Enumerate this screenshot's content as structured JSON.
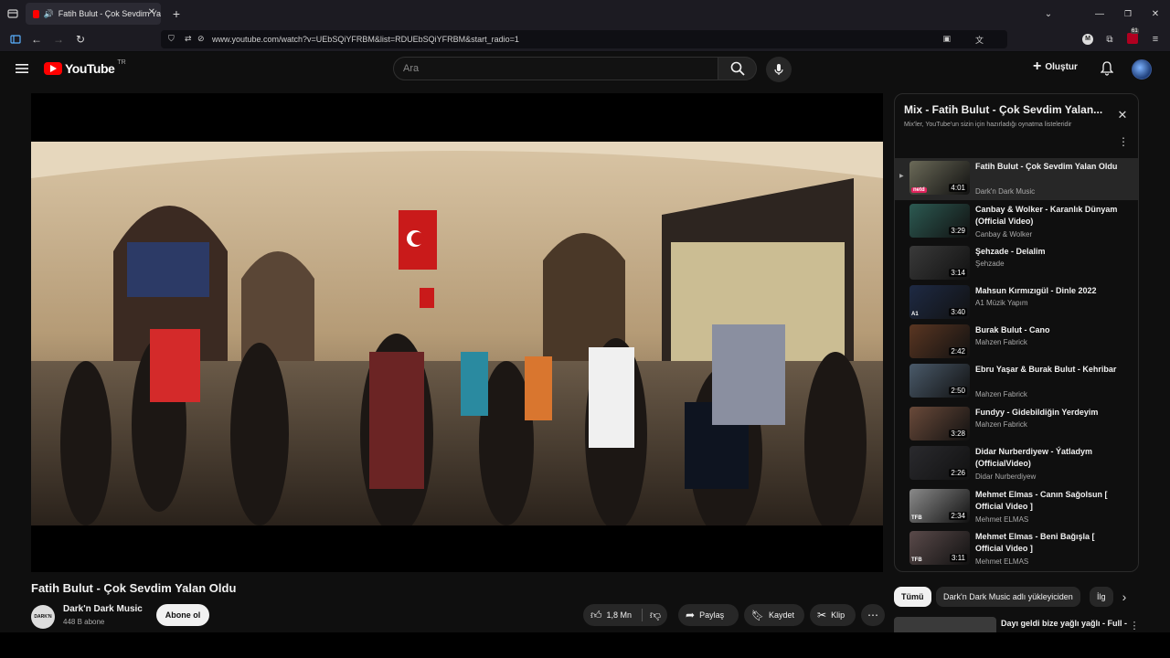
{
  "browser": {
    "tab_title": "Fatih Bulut - Çok Sevdim Ya",
    "url": "www.youtube.com/watch?v=UEbSQiYFRBM&list=RDUEbSQiYFRBM&start_radio=1",
    "new_tab_symbol": "+",
    "ext_badge": "61",
    "ext_m_letter": "M"
  },
  "youtube": {
    "logo_text": "YouTube",
    "region": "TR",
    "search_placeholder": "Ara",
    "create_label": "Oluştur"
  },
  "video": {
    "title": "Fatih Bulut - Çok Sevdim Yalan Oldu",
    "channel": "Dark'n Dark Music",
    "subscribers": "448 B abone",
    "subscribe_label": "Abone ol",
    "likes": "1,8 Mn",
    "share_label": "Paylaş",
    "save_label": "Kaydet",
    "clip_label": "Klip"
  },
  "playlist": {
    "title": "Mix - Fatih Bulut - Çok Sevdim Yalan...",
    "subtitle": "Mix'ler, YouTube'un sizin için hazırladığı oynatma listeleridir",
    "items": [
      {
        "title": "Fatih Bulut - Çok Sevdim Yalan Oldu",
        "channel": "Dark'n Dark Music",
        "duration": "4:01",
        "active": true,
        "thumb_color": "#6b6a58",
        "badge": "netd"
      },
      {
        "title": "Canbay & Wolker - Karanlık Dünyam (Official Video)",
        "channel": "Canbay & Wolker",
        "duration": "3:29",
        "thumb_color": "#2c5a52"
      },
      {
        "title": "Şehzade - Delalim",
        "channel": "Şehzade",
        "duration": "3:14",
        "thumb_color": "#3a3a3a"
      },
      {
        "title": "Mahsun Kırmızıgül - Dinle 2022",
        "channel": "A1 Müzik Yapım",
        "duration": "3:40",
        "thumb_color": "#1e2a44",
        "badge": "A1"
      },
      {
        "title": "Burak Bulut - Cano",
        "channel": "Mahzen Fabrick",
        "duration": "2:42",
        "thumb_color": "#5a3622"
      },
      {
        "title": "Ebru Yaşar & Burak Bulut - Kehribar",
        "channel": "Mahzen Fabrick",
        "duration": "2:50",
        "thumb_color": "#4a5a6a"
      },
      {
        "title": "Fundyy - Gidebildiğin Yerdeyim",
        "channel": "Mahzen Fabrick",
        "duration": "3:28",
        "thumb_color": "#6a4a3a"
      },
      {
        "title": "Didar Nurberdiyew - Ýatladym (OfficialVideo)",
        "channel": "Didar Nurberdiyew",
        "duration": "2:26",
        "thumb_color": "#2a2a2e"
      },
      {
        "title": "Mehmet Elmas - Canın Sağolsun [ Official Video ]",
        "channel": "Mehmet ELMAS",
        "duration": "2:34",
        "thumb_color": "#8a8a8a",
        "badge": "TFB"
      },
      {
        "title": "Mehmet Elmas - Beni Bağışla [ Official Video ]",
        "channel": "Mehmet ELMAS",
        "duration": "3:11",
        "thumb_color": "#5a4a4a",
        "badge": "TFB"
      }
    ]
  },
  "chips": [
    {
      "label": "Tümü",
      "active": true
    },
    {
      "label": "Dark'n Dark Music adlı yükleyiciden",
      "active": false
    },
    {
      "label": "İlg",
      "active": false
    }
  ],
  "next_item": {
    "title": "Dayı geldi bize yağlı yağlı - Full -"
  },
  "colors": {
    "youtube_red": "#ff0000",
    "background": "#0f0f0f",
    "panel": "#272727"
  }
}
